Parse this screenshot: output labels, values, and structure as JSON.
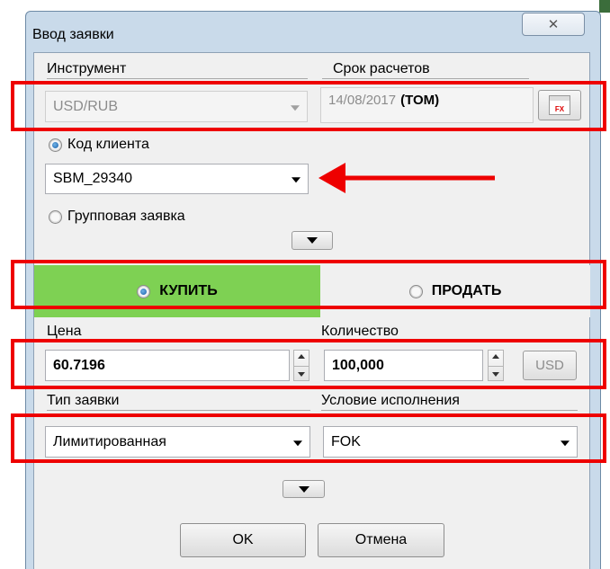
{
  "window": {
    "title": "Ввод заявки",
    "close_icon": "✕"
  },
  "instrument": {
    "label": "Инструмент",
    "value": "USD/RUB"
  },
  "settlement": {
    "label": "Срок расчетов",
    "date": "14/08/2017",
    "tenor": "(TOM)",
    "calendar_icon": "FX"
  },
  "client": {
    "radio_label": "Код клиента",
    "value": "SBM_29340",
    "selected": true
  },
  "group_order": {
    "radio_label": "Групповая заявка",
    "selected": false
  },
  "side": {
    "buy_label": "КУПИТЬ",
    "sell_label": "ПРОДАТЬ",
    "selected": "buy",
    "buy_color": "#7ed153"
  },
  "price": {
    "label": "Цена",
    "value": "60.7196"
  },
  "quantity": {
    "label": "Количество",
    "value": "100,000",
    "currency_button": "USD"
  },
  "order_type": {
    "label": "Тип заявки",
    "value": "Лимитированная"
  },
  "condition": {
    "label": "Условие исполнения",
    "value": "FOK"
  },
  "buttons": {
    "ok": "OK",
    "cancel": "Отмена"
  },
  "annotations": {
    "highlight_color": "#ee0000"
  }
}
